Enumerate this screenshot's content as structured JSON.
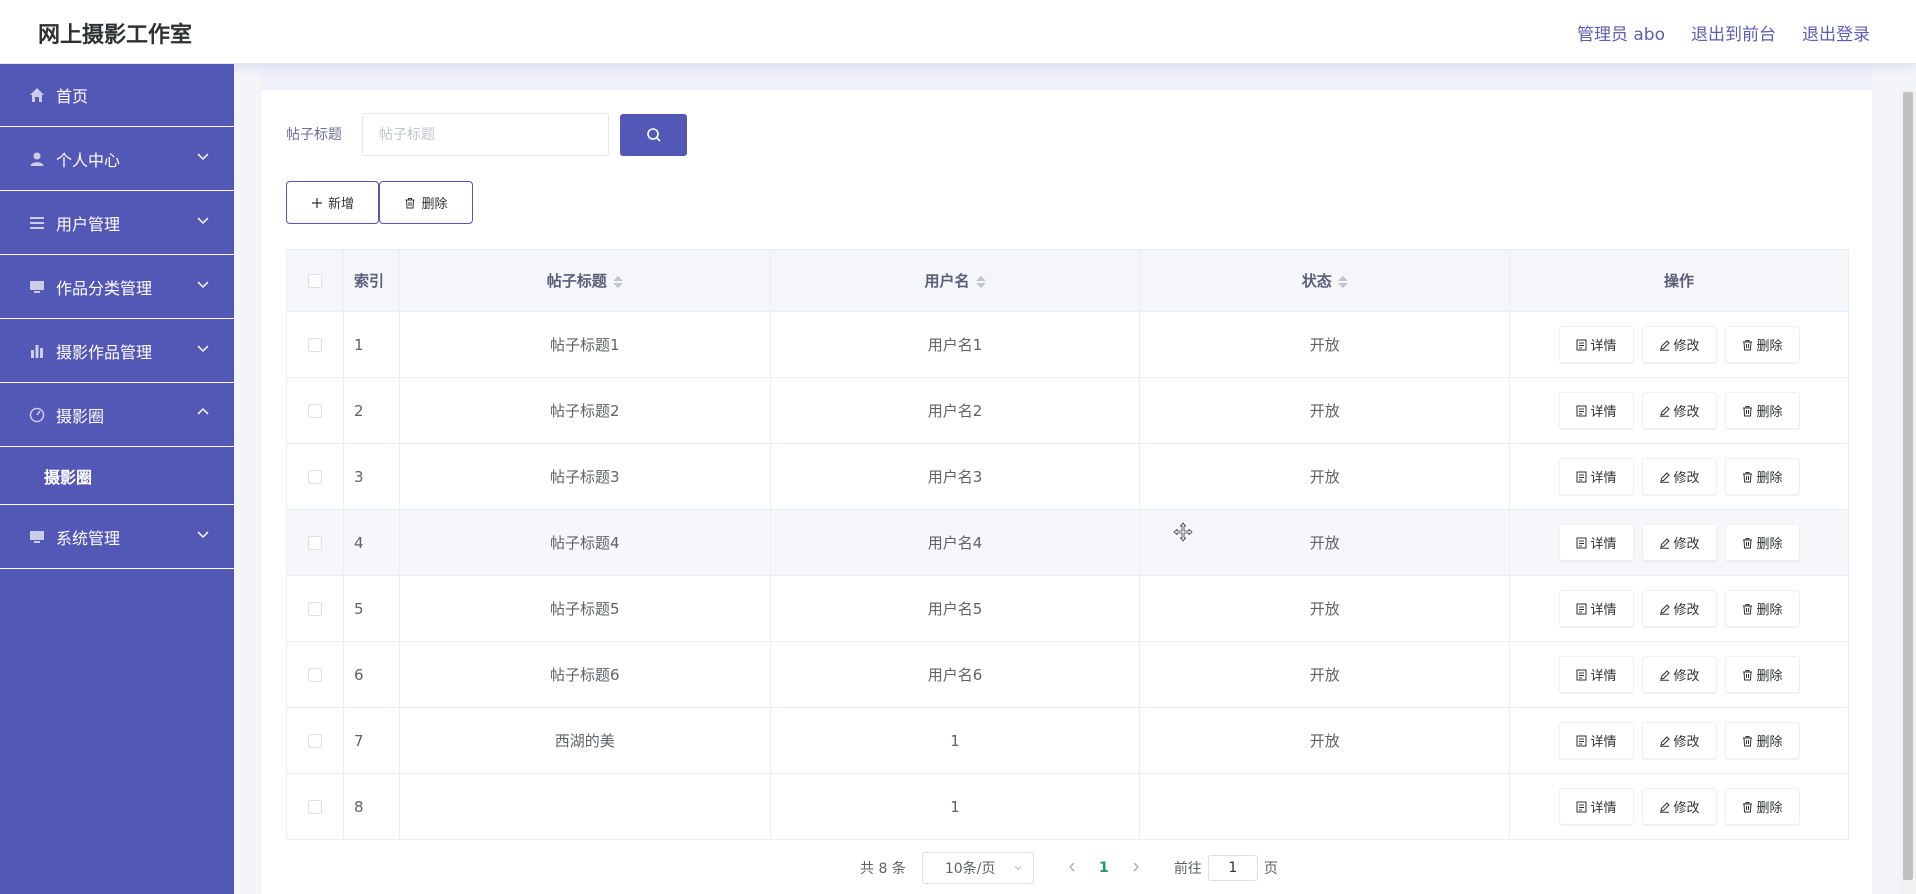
{
  "header": {
    "brand": "网上摄影工作室",
    "admin": "管理员 abo",
    "back_to_front": "退出到前台",
    "logout": "退出登录"
  },
  "sidebar": {
    "items": [
      {
        "label": "首页",
        "icon": "home-icon",
        "expandable": false
      },
      {
        "label": "个人中心",
        "icon": "user-icon",
        "expandable": true
      },
      {
        "label": "用户管理",
        "icon": "list-icon",
        "expandable": true
      },
      {
        "label": "作品分类管理",
        "icon": "monitor-icon",
        "expandable": true
      },
      {
        "label": "摄影作品管理",
        "icon": "bar-chart-icon",
        "expandable": true
      },
      {
        "label": "摄影圈",
        "icon": "gauge-icon",
        "expandable": true,
        "expanded": true
      },
      {
        "label": "系统管理",
        "icon": "monitor-icon",
        "expandable": true
      }
    ],
    "submenu": {
      "label": "摄影圈"
    }
  },
  "search": {
    "label": "帖子标题",
    "placeholder": "帖子标题",
    "value": ""
  },
  "toolbar": {
    "add_label": "新增",
    "delete_label": "删除"
  },
  "table": {
    "headers": {
      "index": "索引",
      "title": "帖子标题",
      "user": "用户名",
      "status": "状态",
      "ops": "操作"
    },
    "op_labels": {
      "detail": "详情",
      "edit": "修改",
      "delete": "删除"
    },
    "rows": [
      {
        "index": "1",
        "title": "帖子标题1",
        "user": "用户名1",
        "status": "开放"
      },
      {
        "index": "2",
        "title": "帖子标题2",
        "user": "用户名2",
        "status": "开放"
      },
      {
        "index": "3",
        "title": "帖子标题3",
        "user": "用户名3",
        "status": "开放"
      },
      {
        "index": "4",
        "title": "帖子标题4",
        "user": "用户名4",
        "status": "开放"
      },
      {
        "index": "5",
        "title": "帖子标题5",
        "user": "用户名5",
        "status": "开放"
      },
      {
        "index": "6",
        "title": "帖子标题6",
        "user": "用户名6",
        "status": "开放"
      },
      {
        "index": "7",
        "title": "西湖的美",
        "user": "1",
        "status": "开放"
      },
      {
        "index": "8",
        "title": "",
        "user": "1",
        "status": ""
      }
    ]
  },
  "pagination": {
    "total": "共 8 条",
    "page_size": "10条/页",
    "current_page": "1",
    "goto_label": "前往",
    "goto_value": "1",
    "goto_unit": "页"
  },
  "colors": {
    "accent": "#5358b6",
    "active_page": "#18a058"
  }
}
